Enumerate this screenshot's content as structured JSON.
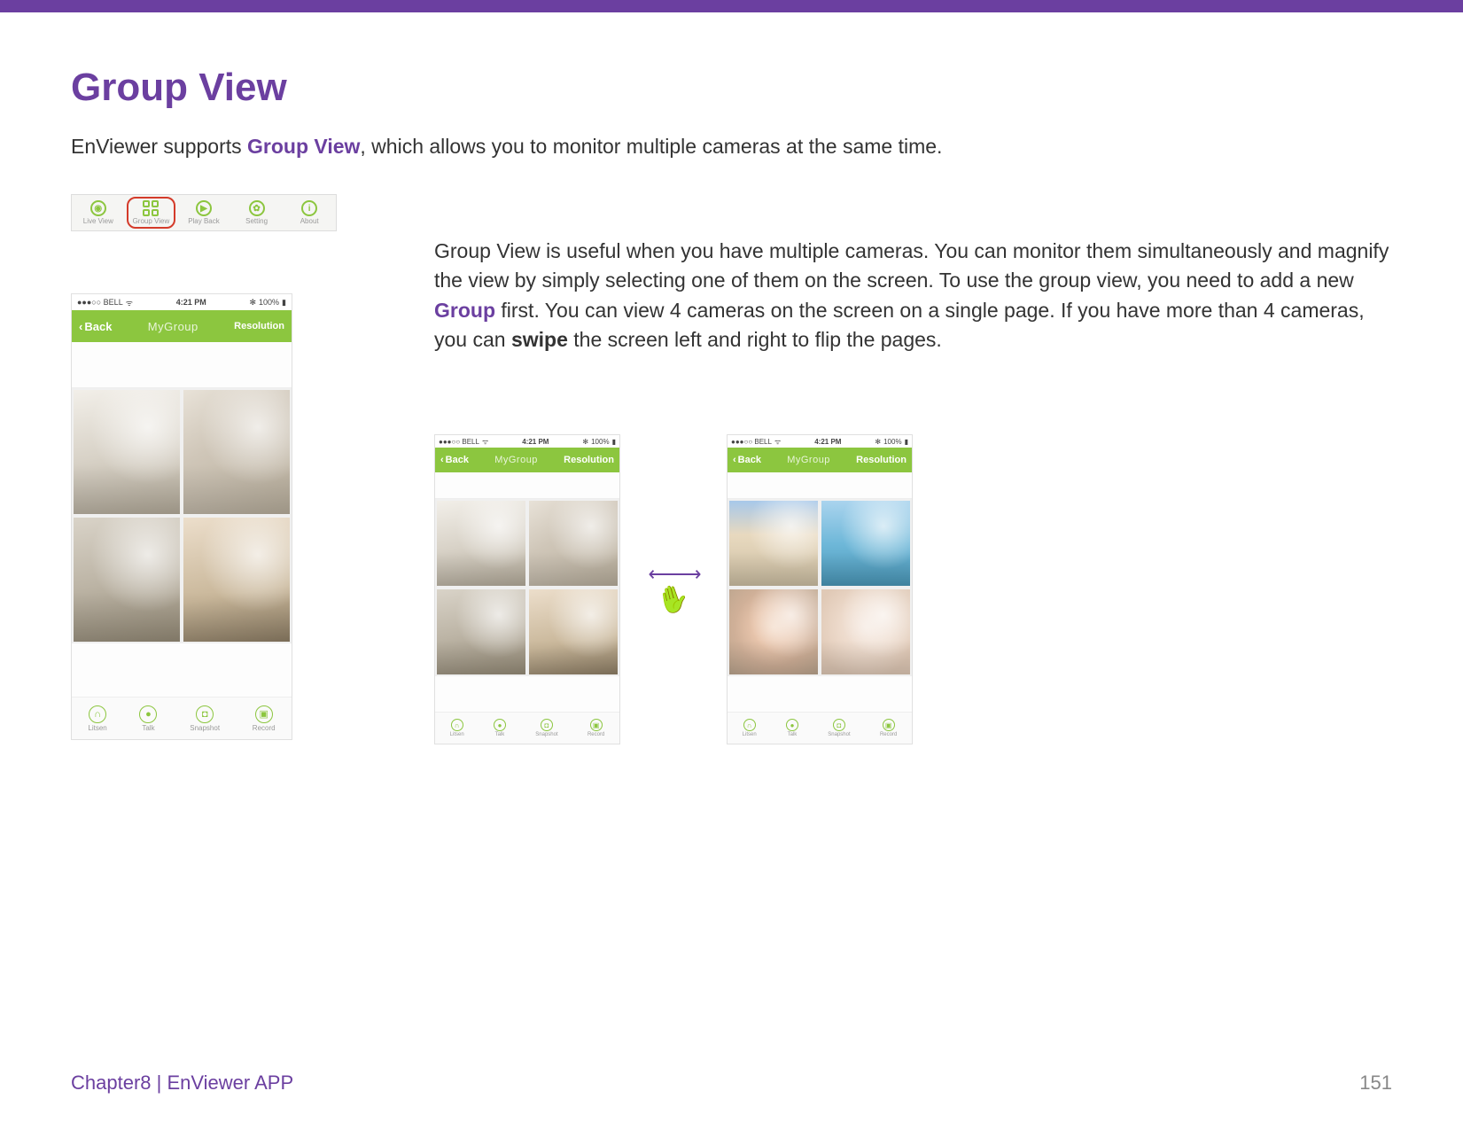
{
  "title": "Group View",
  "intro_pre": "EnViewer supports ",
  "intro_accent": "Group View",
  "intro_post": ", which allows you to monitor multiple cameras at the same time.",
  "para": {
    "t1": "Group View is useful when you have multiple cameras. You can monitor them simultaneously and magnify the view by simply selecting one of them on the screen. To use the group view, you need to add a new ",
    "group_word": "Group",
    "t2": " first. You can view 4 cameras on the screen on a single page. If you have more than 4 cameras, you can ",
    "swipe_word": "swipe",
    "t3": " the screen left and right to flip the pages."
  },
  "tabs": {
    "live": "Live View",
    "group": "Group View",
    "play": "Play Back",
    "setting": "Setting",
    "about": "About"
  },
  "phone": {
    "carrier": "●●●○○ BELL",
    "wifi": "ᯤ",
    "time": "4:21 PM",
    "bt": "✻",
    "battery_pct": "100%",
    "back": "Back",
    "title": "MyGroup",
    "resolution": "Resolution",
    "bottom": {
      "listen": "Litsen",
      "talk": "Talk",
      "snapshot": "Snapshot",
      "record": "Record"
    }
  },
  "footer": {
    "chapter": "Chapter8  |  EnViewer APP",
    "page": "151"
  }
}
